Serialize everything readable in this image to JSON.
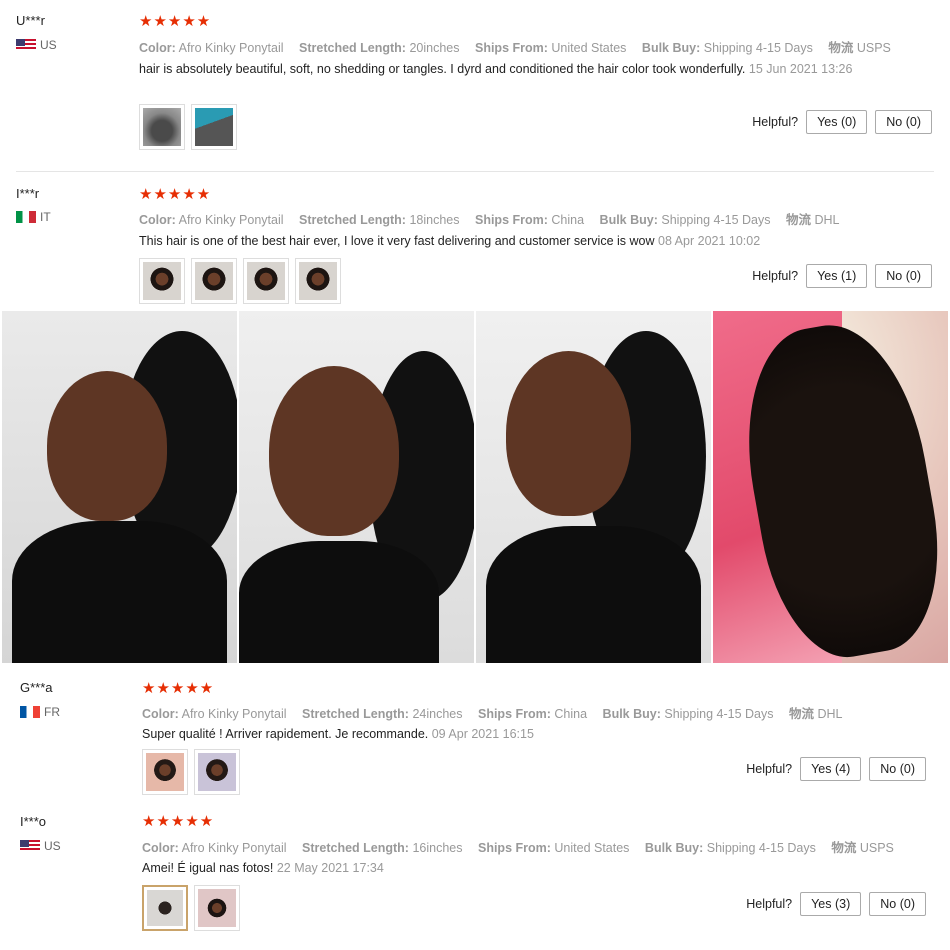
{
  "reviews": [
    {
      "user": "U***r",
      "country": "US",
      "flag": "flag-us",
      "stars": "★★★★★",
      "attrs": {
        "color_label": "Color:",
        "color": "Afro Kinky Ponytail",
        "length_label": "Stretched Length:",
        "length": "20inches",
        "ships_label": "Ships From:",
        "ships": "United States",
        "bulk_label": "Bulk Buy:",
        "bulk": "Shipping 4-15 Days",
        "logistics_label": "物流",
        "logistics": "USPS"
      },
      "text": "hair is absolutely beautiful, soft, no shedding or tangles. I dyrd and conditioned the hair color took wonderfully.",
      "date": "15 Jun 2021 13:26",
      "helpful_label": "Helpful?",
      "yes": "Yes (0)",
      "no": "No (0)"
    },
    {
      "user": "I***r",
      "country": "IT",
      "flag": "flag-it",
      "stars": "★★★★★",
      "attrs": {
        "color_label": "Color:",
        "color": "Afro Kinky Ponytail",
        "length_label": "Stretched Length:",
        "length": "18inches",
        "ships_label": "Ships From:",
        "ships": "China",
        "bulk_label": "Bulk Buy:",
        "bulk": "Shipping 4-15 Days",
        "logistics_label": "物流",
        "logistics": "DHL"
      },
      "text": "This hair is one of the best hair ever, I love it very fast delivering and customer service is wow",
      "date": "08 Apr 2021 10:02",
      "helpful_label": "Helpful?",
      "yes": "Yes (1)",
      "no": "No (0)"
    },
    {
      "user": "G***a",
      "country": "FR",
      "flag": "flag-fr",
      "stars": "★★★★★",
      "attrs": {
        "color_label": "Color:",
        "color": "Afro Kinky Ponytail",
        "length_label": "Stretched Length:",
        "length": "24inches",
        "ships_label": "Ships From:",
        "ships": "China",
        "bulk_label": "Bulk Buy:",
        "bulk": "Shipping 4-15 Days",
        "logistics_label": "物流",
        "logistics": "DHL"
      },
      "text": "Super qualité ! Arriver rapidement. Je recommande.",
      "date": "09 Apr 2021 16:15",
      "helpful_label": "Helpful?",
      "yes": "Yes (4)",
      "no": "No (0)"
    },
    {
      "user": "I***o",
      "country": "US",
      "flag": "flag-us",
      "stars": "★★★★★",
      "attrs": {
        "color_label": "Color:",
        "color": "Afro Kinky Ponytail",
        "length_label": "Stretched Length:",
        "length": "16inches",
        "ships_label": "Ships From:",
        "ships": "United States",
        "bulk_label": "Bulk Buy:",
        "bulk": "Shipping 4-15 Days",
        "logistics_label": "物流",
        "logistics": "USPS"
      },
      "text": "Amei! É igual nas fotos!",
      "date": "22 May 2021 17:34",
      "helpful_label": "Helpful?",
      "yes": "Yes (3)",
      "no": "No (0)"
    }
  ],
  "colors": {
    "star": "#e62e04",
    "muted": "#999999",
    "selected_thumb_border": "#c9a36a"
  }
}
